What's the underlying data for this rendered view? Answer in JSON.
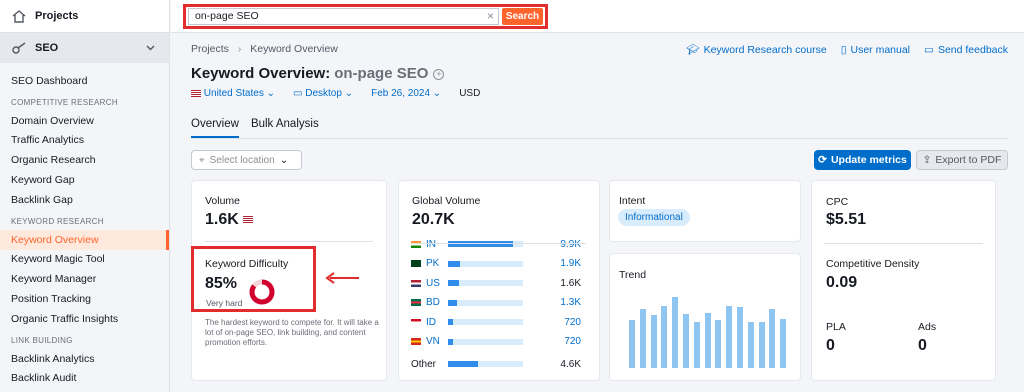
{
  "sidebar": {
    "projects": "Projects",
    "seo": "SEO",
    "dashboard": "SEO Dashboard",
    "sections": [
      {
        "title": "COMPETITIVE RESEARCH",
        "items": [
          "Domain Overview",
          "Traffic Analytics",
          "Organic Research",
          "Keyword Gap",
          "Backlink Gap"
        ]
      },
      {
        "title": "KEYWORD RESEARCH",
        "items": [
          "Keyword Overview",
          "Keyword Magic Tool",
          "Keyword Manager",
          "Position Tracking",
          "Organic Traffic Insights"
        ]
      },
      {
        "title": "LINK BUILDING",
        "items": [
          "Backlink Analytics",
          "Backlink Audit"
        ]
      }
    ]
  },
  "search": {
    "value": "on-page SEO",
    "button": "Search"
  },
  "breadcrumb": {
    "root": "Projects",
    "current": "Keyword Overview"
  },
  "links": {
    "course": "Keyword Research course",
    "manual": "User manual",
    "feedback": "Send feedback"
  },
  "title": {
    "label": "Keyword Overview:",
    "keyword": "on-page SEO"
  },
  "filters": {
    "country": "United States",
    "device": "Desktop",
    "date": "Feb 26, 2024",
    "currency": "USD"
  },
  "tabs": [
    "Overview",
    "Bulk Analysis"
  ],
  "location": "Select location",
  "buttons": {
    "update": "Update metrics",
    "export": "Export to PDF"
  },
  "volume": {
    "label": "Volume",
    "value": "1.6K"
  },
  "kd": {
    "label": "Keyword Difficulty",
    "value": "85%",
    "level": "Very hard",
    "percent": 85,
    "desc": "The hardest keyword to compete for. It will take a lot of on-page SEO, link building, and content promotion efforts.",
    "color": "#d1002f"
  },
  "global": {
    "label": "Global Volume",
    "value": "20.7K",
    "rows": [
      {
        "cc": "IN",
        "value": "9.9K",
        "share": 0.48
      },
      {
        "cc": "PK",
        "value": "1.9K",
        "share": 0.09
      },
      {
        "cc": "US",
        "value": "1.6K",
        "share": 0.08
      },
      {
        "cc": "BD",
        "value": "1.3K",
        "share": 0.065
      },
      {
        "cc": "ID",
        "value": "720",
        "share": 0.035
      },
      {
        "cc": "VN",
        "value": "720",
        "share": 0.035
      }
    ],
    "other": {
      "cc": "Other",
      "value": "4.6K",
      "share": 0.22
    }
  },
  "intent": {
    "label": "Intent",
    "value": "Informational"
  },
  "trend": {
    "label": "Trend",
    "values": [
      0.63,
      0.78,
      0.7,
      0.82,
      0.93,
      0.71,
      0.6,
      0.72,
      0.63,
      0.82,
      0.8,
      0.6,
      0.6,
      0.78,
      0.65
    ]
  },
  "cpc": {
    "label": "CPC",
    "value": "$5.51"
  },
  "density": {
    "label": "Competitive Density",
    "value": "0.09"
  },
  "pla": {
    "label": "PLA",
    "value": "0"
  },
  "ads": {
    "label": "Ads",
    "value": "0"
  },
  "colors": {
    "accent": "#ff642d",
    "link": "#006dca",
    "annotation": "#e12d2d"
  }
}
